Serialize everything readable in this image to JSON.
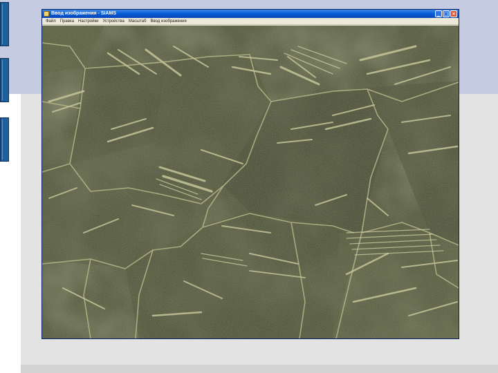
{
  "window": {
    "title": "Ввод изображения - SIAMS",
    "buttons": {
      "minimize": "_",
      "maximize": "□",
      "close": "×"
    }
  },
  "menu": {
    "items": [
      {
        "label": "Файл"
      },
      {
        "label": "Правка"
      },
      {
        "label": "Настройки"
      },
      {
        "label": "Устройства"
      },
      {
        "label": "Масштаб"
      },
      {
        "label": "Ввод изображения"
      }
    ]
  },
  "image": {
    "subject": "metallographic-micrograph",
    "colors": {
      "background": "#4d5137",
      "grain_dark": "#424530",
      "grain_light": "#5c6043",
      "boundary": "#b9b88e",
      "needle": "#c8c79d"
    }
  },
  "slide": {
    "colors": {
      "top_band": "#c5cbe0",
      "panel": "#e3e3e3",
      "side_tab": "#1f5f9c"
    }
  }
}
